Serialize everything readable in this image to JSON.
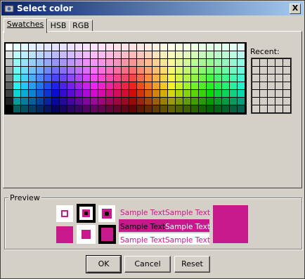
{
  "window": {
    "title": "Select color",
    "close_label": "X"
  },
  "tabs": [
    {
      "label": "Swatches",
      "active": true
    },
    {
      "label": "HSB",
      "active": false
    },
    {
      "label": "RGB",
      "active": false
    }
  ],
  "swatches": {
    "recent_label": "Recent:"
  },
  "preview": {
    "label": "Preview",
    "sample_text": "Sample Text",
    "selected_color": "#c8188c"
  },
  "buttons": {
    "ok": "OK",
    "cancel": "Cancel",
    "reset": "Reset"
  },
  "colors": {
    "titlebar_start": "#0a246a",
    "titlebar_end": "#a6caf0",
    "face": "#d4d0c8"
  }
}
